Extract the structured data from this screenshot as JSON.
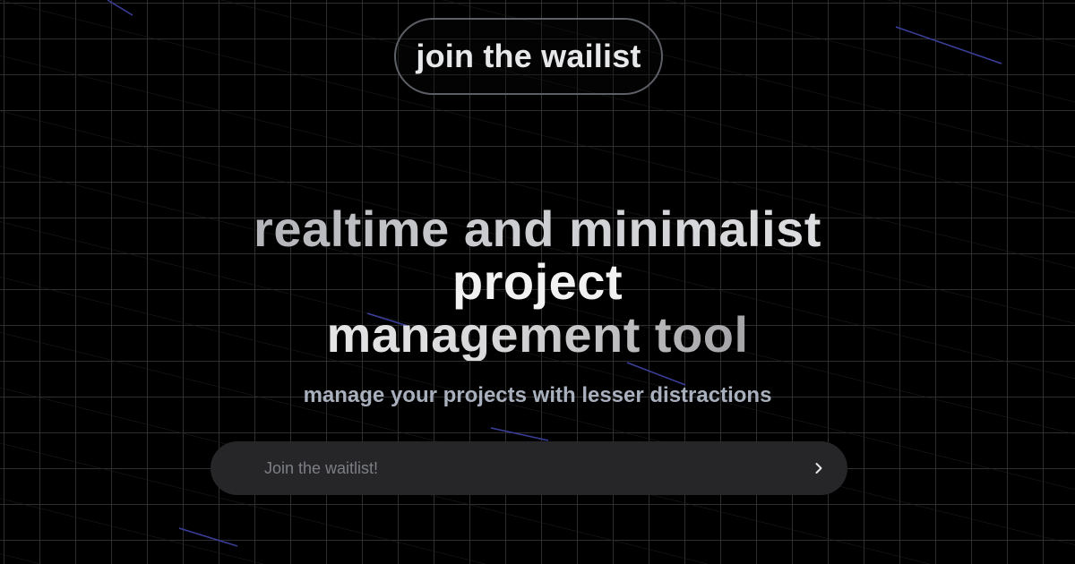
{
  "header": {
    "join_button_label": "join the wailist"
  },
  "hero": {
    "title_line_1": "realtime and minimalist",
    "title_line_2": "project",
    "title_line_3": "management tool",
    "subtitle": "manage your projects with lesser distractions"
  },
  "waitlist": {
    "placeholder": "Join the waitlist!",
    "value": "",
    "submit_icon": "chevron-right-icon"
  },
  "colors": {
    "background": "#000000",
    "grid_line": "#2f2f2f",
    "input_bg": "#262628",
    "subtitle": "#a9b0bd",
    "streak_accent": "#5a5fd6"
  }
}
